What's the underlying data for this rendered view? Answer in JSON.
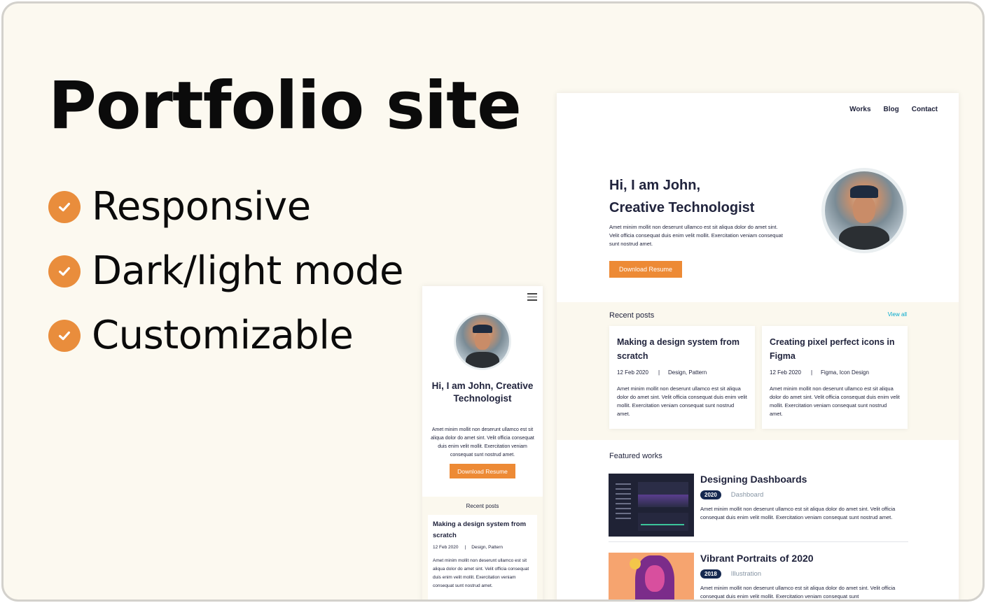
{
  "hero": {
    "title": "Portfolio site",
    "features": [
      "Responsive",
      "Dark/light mode",
      "Customizable"
    ]
  },
  "desktop": {
    "nav": [
      "Works",
      "Blog",
      "Contact"
    ],
    "hello_line1": "Hi, I am John,",
    "hello_line2": "Creative Technologist",
    "intro": "Amet minim mollit non deserunt ullamco est sit aliqua dolor do amet sint. Velit officia consequat duis enim velit mollit. Exercitation veniam consequat sunt nostrud amet.",
    "button": "Download Resume",
    "recent_heading": "Recent posts",
    "view_all": "View all",
    "posts": [
      {
        "title": "Making a design system from scratch",
        "date": "12 Feb 2020",
        "sep": "|",
        "tags": "Design, Pattern",
        "body": "Amet minim mollit non deserunt ullamco est sit aliqua dolor do amet sint. Velit officia consequat duis enim velit mollit. Exercitation veniam consequat sunt nostrud amet."
      },
      {
        "title": "Creating pixel perfect icons in Figma",
        "date": "12 Feb 2020",
        "sep": "|",
        "tags": "Figma, Icon Design",
        "body": "Amet minim mollit non deserunt ullamco est sit aliqua dolor do amet sint. Velit officia consequat duis enim velit mollit. Exercitation veniam consequat sunt nostrud amet."
      }
    ],
    "featured_heading": "Featured works",
    "works": [
      {
        "title": "Designing Dashboards",
        "year": "2020",
        "category": "Dashboard",
        "desc": "Amet minim mollit non deserunt ullamco est sit aliqua dolor do amet sint. Velit officia consequat duis enim velit mollit. Exercitation veniam consequat sunt nostrud amet."
      },
      {
        "title": "Vibrant Portraits of 2020",
        "year": "2018",
        "category": "Illustration",
        "desc": "Amet minim mollit non deserunt ullamco est sit aliqua dolor do amet sint. Velit officia consequat duis enim velit mollit. Exercitation veniam consequat sunt"
      }
    ]
  },
  "mobile": {
    "hello": "Hi, I am John, Creative Technologist",
    "intro": "Amet minim mollit non deserunt ullamco est sit aliqua dolor do amet sint. Velit officia consequat duis enim velit mollit. Exercitation veniam consequat sunt nostrud amet.",
    "button": "Download Resume",
    "recent_heading": "Recent posts",
    "post": {
      "title": "Making a design system from scratch",
      "date": "12 Feb 2020",
      "sep": "|",
      "tags": "Design, Pattern",
      "body": "Amet minim mollit non deserunt ullamco est sit aliqua dolor do amet sint. Velit officia consequat duis enim velit mollit. Exercitation veniam consequat sunt nostrud amet."
    }
  },
  "colors": {
    "accent": "#e98d3c",
    "background": "#fcf9f0",
    "link": "#00a8cc",
    "badge": "#142850"
  },
  "icons": [
    "check-icon",
    "hamburger-menu-icon"
  ]
}
